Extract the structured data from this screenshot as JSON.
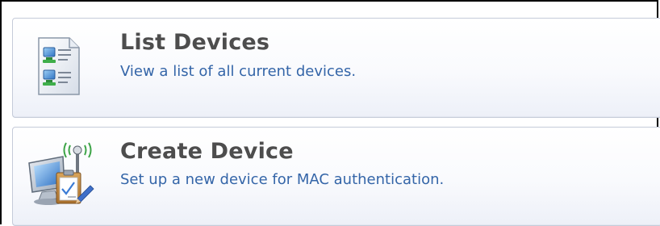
{
  "menu": {
    "items": [
      {
        "title": "List Devices",
        "description": "View a list of all current devices.",
        "icon": "device-list-icon"
      },
      {
        "title": "Create Device",
        "description": "Set up a new device for MAC authentication.",
        "icon": "create-device-icon"
      }
    ]
  },
  "colors": {
    "title_text": "#4d4d4d",
    "description_text": "#3465a8",
    "card_border": "#c5cbd9"
  }
}
